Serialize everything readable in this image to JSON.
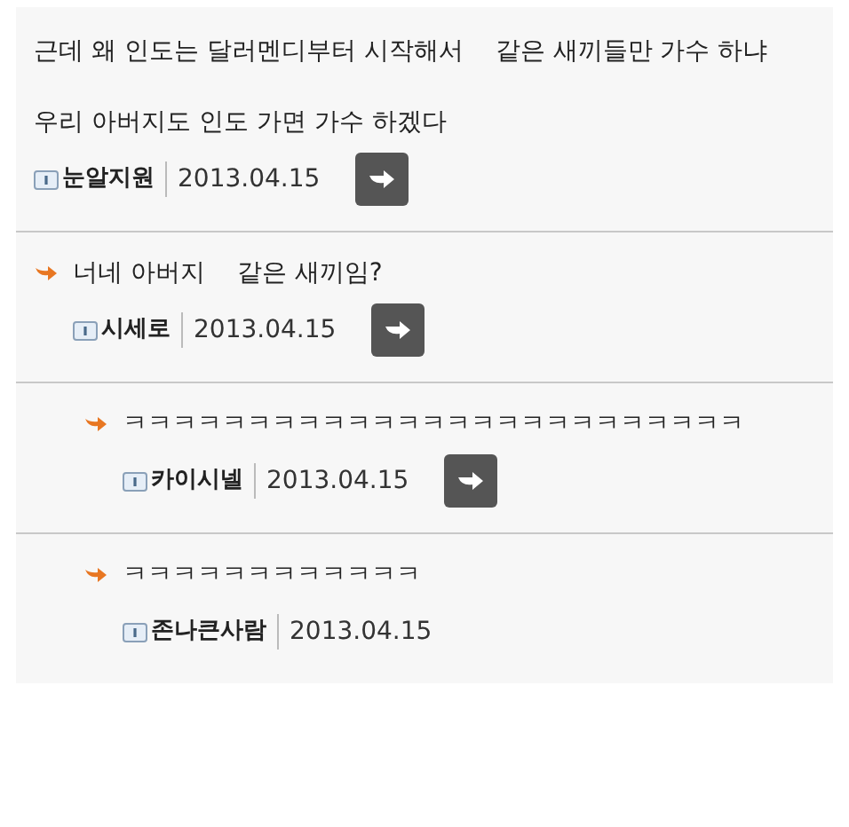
{
  "comments": [
    {
      "paragraphs": [
        [
          "근데 왜 인도는 달러멘디부터 시작해서",
          "같은 새끼들만 가수 하냐"
        ],
        [
          "우리 아버지도 인도 가면 가수 하겠다"
        ]
      ],
      "author": "눈알지원",
      "date": "2013.04.15",
      "arrow_button": true,
      "children": [
        {
          "paragraphs": [
            [
              "너네 아버지",
              "같은 새끼임?"
            ]
          ],
          "author": "시세로",
          "date": "2013.04.15",
          "arrow_button": true,
          "children": [
            {
              "paragraphs": [
                [
                  "ㅋㅋㅋㅋㅋㅋㅋㅋㅋㅋㅋㅋㅋㅋㅋㅋㅋㅋㅋㅋㅋㅋㅋㅋㅋ"
                ]
              ],
              "author": "카이시넬",
              "date": "2013.04.15",
              "arrow_button": true
            },
            {
              "paragraphs": [
                [
                  "ㅋㅋㅋㅋㅋㅋㅋㅋㅋㅋㅋㅋ"
                ]
              ],
              "author": "존나큰사람",
              "date": "2013.04.15",
              "arrow_button": false
            }
          ]
        }
      ]
    }
  ]
}
